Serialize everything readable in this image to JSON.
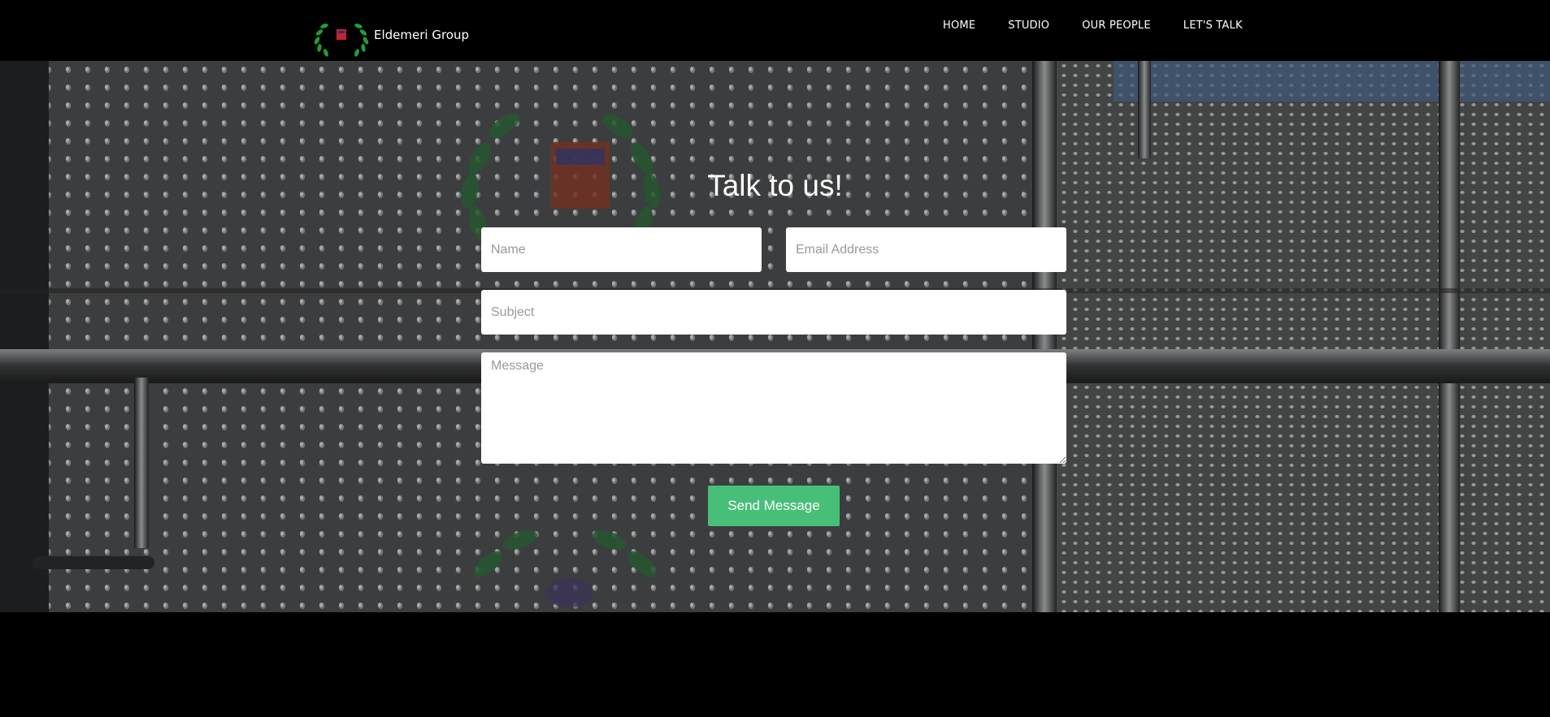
{
  "header": {
    "brand_name": "Eldemeri Group",
    "nav": [
      "HOME",
      "STUDIO",
      "OUR PEOPLE",
      "LET'S TALK"
    ]
  },
  "contact": {
    "title": "Talk to us!",
    "name_placeholder": "Name",
    "email_placeholder": "Email Address",
    "subject_placeholder": "Subject",
    "message_placeholder": "Message",
    "send_label": "Send Message"
  },
  "colors": {
    "accent": "#48bf78",
    "logo_green": "#1fa12f",
    "logo_red": "#c0262b"
  }
}
